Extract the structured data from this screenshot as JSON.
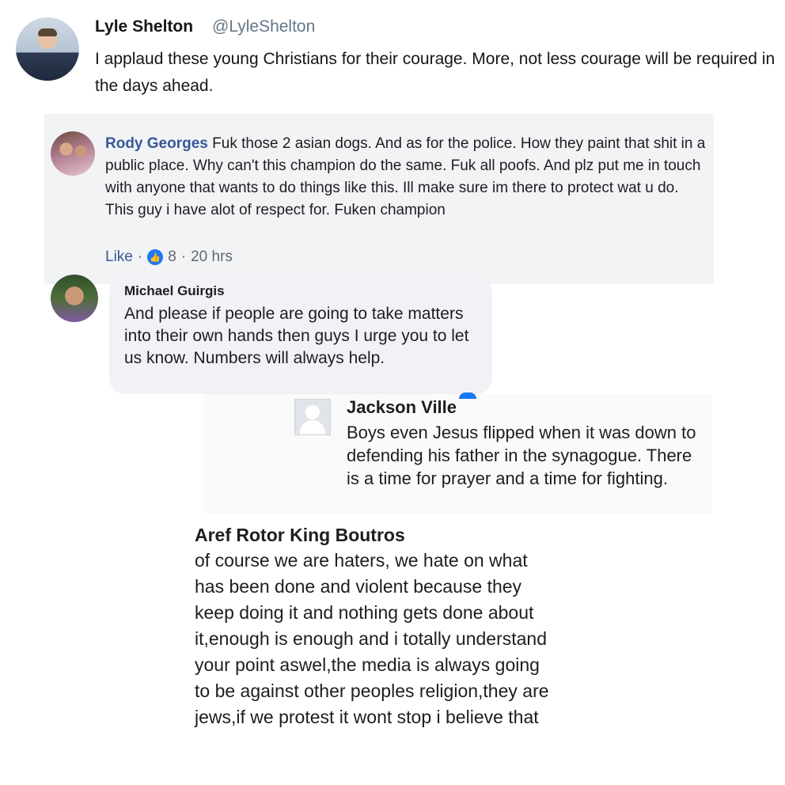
{
  "tweet": {
    "name": "Lyle Shelton",
    "handle": "@LyleShelton",
    "text": "I applaud these young Christians for their courage. More, not less courage will be required in the days ahead."
  },
  "comment1": {
    "author": "Rody Georges",
    "text": "Fuk those 2 asian dogs. And as for the police. How they paint that shit in a public place. Why can't this champion do the same. Fuk all poofs. And plz put me in touch with anyone that wants to do things like this. Ill make sure im there to protect wat u do. This guy i have alot of respect for. Fuken champion",
    "like_label": "Like",
    "separator": "·",
    "like_count": "8",
    "time": "20 hrs"
  },
  "comment2": {
    "author": "Michael Guirgis",
    "text": "And please if people are going to take matters into their own hands then guys I urge you to let us know. Numbers will always help."
  },
  "comment3": {
    "author": "Jackson Ville",
    "text": "Boys even Jesus flipped when it was down to defending his father in the synagogue. There is a time for prayer and a time for fighting."
  },
  "comment4": {
    "author": "Aref Rotor King Boutros",
    "text": "of course we are haters, we hate on what has been done and violent because they keep doing it and nothing gets done about it,enough is enough and i totally understand your point aswel,the media is always going to be against other peoples religion,they are jews,if we protest it wont stop i believe that"
  },
  "colors": {
    "fb_link": "#385898",
    "fb_like_blue": "#2078f4",
    "twitter_handle": "#657786"
  }
}
